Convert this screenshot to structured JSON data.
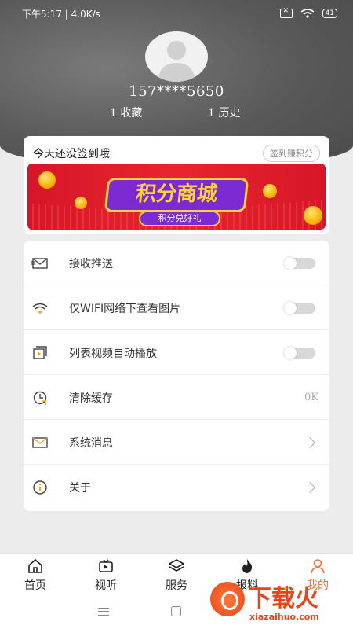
{
  "status_bar": {
    "time_speed": "下午5:17 | 4.0K/s",
    "battery": "41"
  },
  "profile": {
    "phone": "157****5650",
    "favorites": "1 收藏",
    "history": "1 历史"
  },
  "signin": {
    "prompt": "今天还没签到哦",
    "button": "签到赚积分",
    "banner_title": "积分商城",
    "banner_sub": "积分兑好礼"
  },
  "settings": {
    "items": [
      {
        "label": "接收推送",
        "icon": "envelope-push-icon",
        "control": "toggle",
        "on": false
      },
      {
        "label": "仅WIFI网络下查看图片",
        "icon": "wifi-icon",
        "control": "toggle",
        "on": false
      },
      {
        "label": "列表视频自动播放",
        "icon": "video-play-icon",
        "control": "toggle",
        "on": false
      },
      {
        "label": "清除缓存",
        "icon": "clock-refresh-icon",
        "control": "value",
        "value": "0K"
      },
      {
        "label": "系统消息",
        "icon": "mail-icon",
        "control": "chevron"
      },
      {
        "label": "关于",
        "icon": "info-icon",
        "control": "chevron"
      }
    ]
  },
  "tabbar": {
    "tabs": [
      {
        "label": "首页",
        "icon": "home-icon"
      },
      {
        "label": "视听",
        "icon": "tv-icon"
      },
      {
        "label": "服务",
        "icon": "layers-icon"
      },
      {
        "label": "报料",
        "icon": "flame-icon"
      },
      {
        "label": "我的",
        "icon": "person-icon",
        "active": true
      }
    ],
    "active_color": "#e8723a"
  },
  "watermark": {
    "brand": "下载火",
    "url": "xiazaihuo.com"
  }
}
